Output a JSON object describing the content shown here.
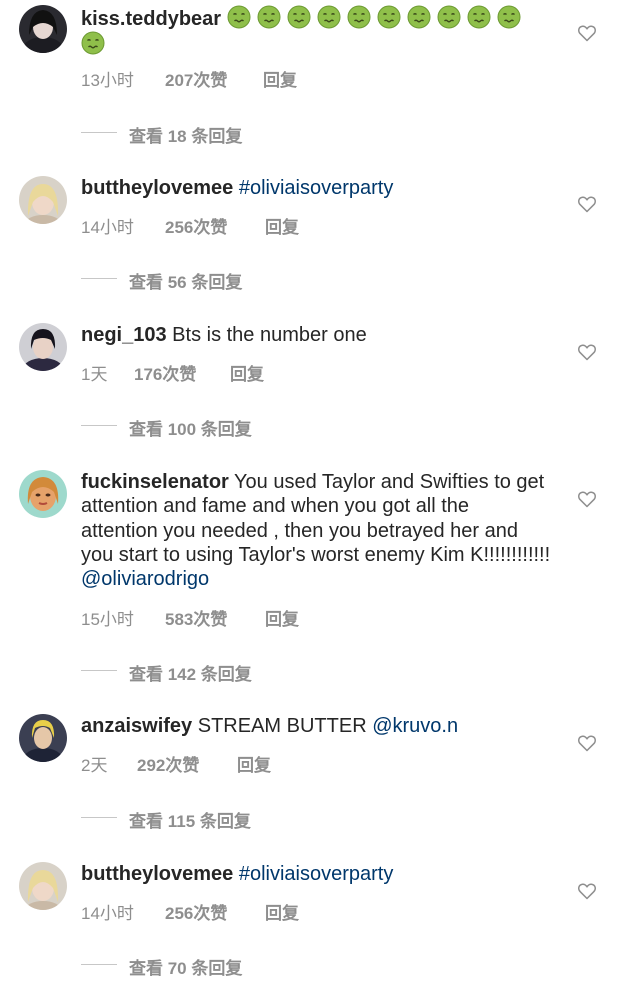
{
  "comments": [
    {
      "username": "kiss.teddybear",
      "text": "",
      "emoji_count": 11,
      "emoji_icon": "nauseated-face-icon",
      "time": "13小时",
      "likes": "207次赞",
      "reply": "回复",
      "view_replies": "查看 18 条回复"
    },
    {
      "username": "buttheylovemee",
      "text": "",
      "mention": "#oliviaisoverparty",
      "time": "14小时",
      "likes": "256次赞",
      "reply": "回复",
      "view_replies": "查看 56 条回复"
    },
    {
      "username": "negi_103",
      "text": "Bts is the number one",
      "time": "1天",
      "likes": "176次赞",
      "reply": "回复",
      "view_replies": "查看 100 条回复"
    },
    {
      "username": "fuckinselenator",
      "text": "You used Taylor and Swifties to get attention and fame and when you got all the attention you needed , then you betrayed her and you start to using Taylor's worst enemy Kim K!!!!!!!!!!!!",
      "mention": "@oliviarodrigo",
      "time": "15小时",
      "likes": "583次赞",
      "reply": "回复",
      "view_replies": "查看 142 条回复"
    },
    {
      "username": "anzaiswifey",
      "text": "STREAM BUTTER",
      "mention": "@kruvo.n",
      "time": "2天",
      "likes": "292次赞",
      "reply": "回复",
      "view_replies": "查看 115 条回复"
    },
    {
      "username": "buttheylovemee",
      "text": "",
      "mention": "#oliviaisoverparty",
      "time": "14小时",
      "likes": "256次赞",
      "reply": "回复",
      "view_replies": "查看 70 条回复"
    }
  ],
  "colors": {
    "text": "#262626",
    "meta": "#8e8e8e",
    "mention": "#00376b"
  }
}
